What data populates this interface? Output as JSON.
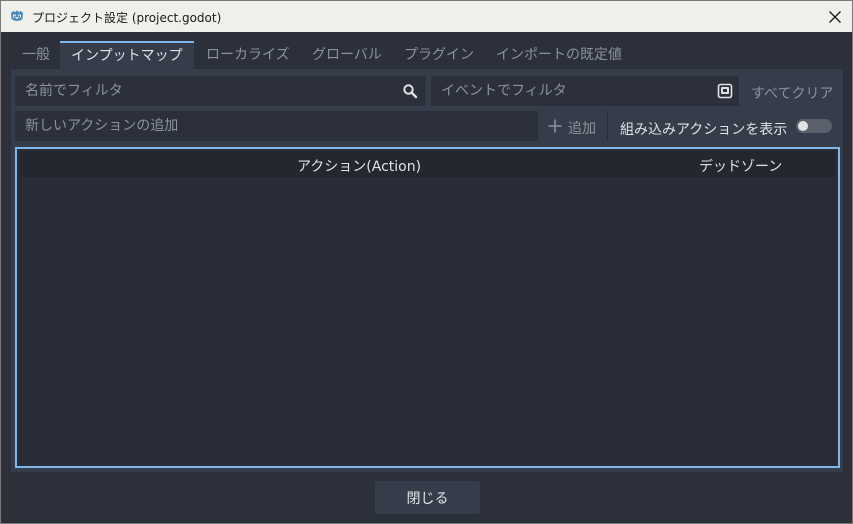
{
  "window": {
    "title": "プロジェクト設定 (project.godot)",
    "app_icon": "godot-icon",
    "close_icon": "close-icon"
  },
  "tabs": [
    {
      "label": "一般",
      "active": false
    },
    {
      "label": "インプットマップ",
      "active": true
    },
    {
      "label": "ローカライズ",
      "active": false
    },
    {
      "label": "グローバル",
      "active": false
    },
    {
      "label": "プラグイン",
      "active": false
    },
    {
      "label": "インポートの既定値",
      "active": false
    }
  ],
  "filters": {
    "name_placeholder": "名前でフィルタ",
    "name_icon": "search-icon",
    "event_placeholder": "イベントでフィルタ",
    "event_icon": "keyboard-icon",
    "clear_all_label": "すべてクリア"
  },
  "add_action": {
    "placeholder": "新しいアクションの追加",
    "add_label": "追加",
    "add_icon": "plus-icon",
    "show_builtin_label": "組み込みアクションを表示",
    "show_builtin_enabled": false
  },
  "table": {
    "columns": [
      "アクション(Action)",
      "デッドゾーン"
    ],
    "rows": []
  },
  "footer": {
    "close_label": "閉じる"
  },
  "colors": {
    "accent": "#7eb7e8",
    "background": "#2b303a",
    "panel": "#363d4a"
  }
}
